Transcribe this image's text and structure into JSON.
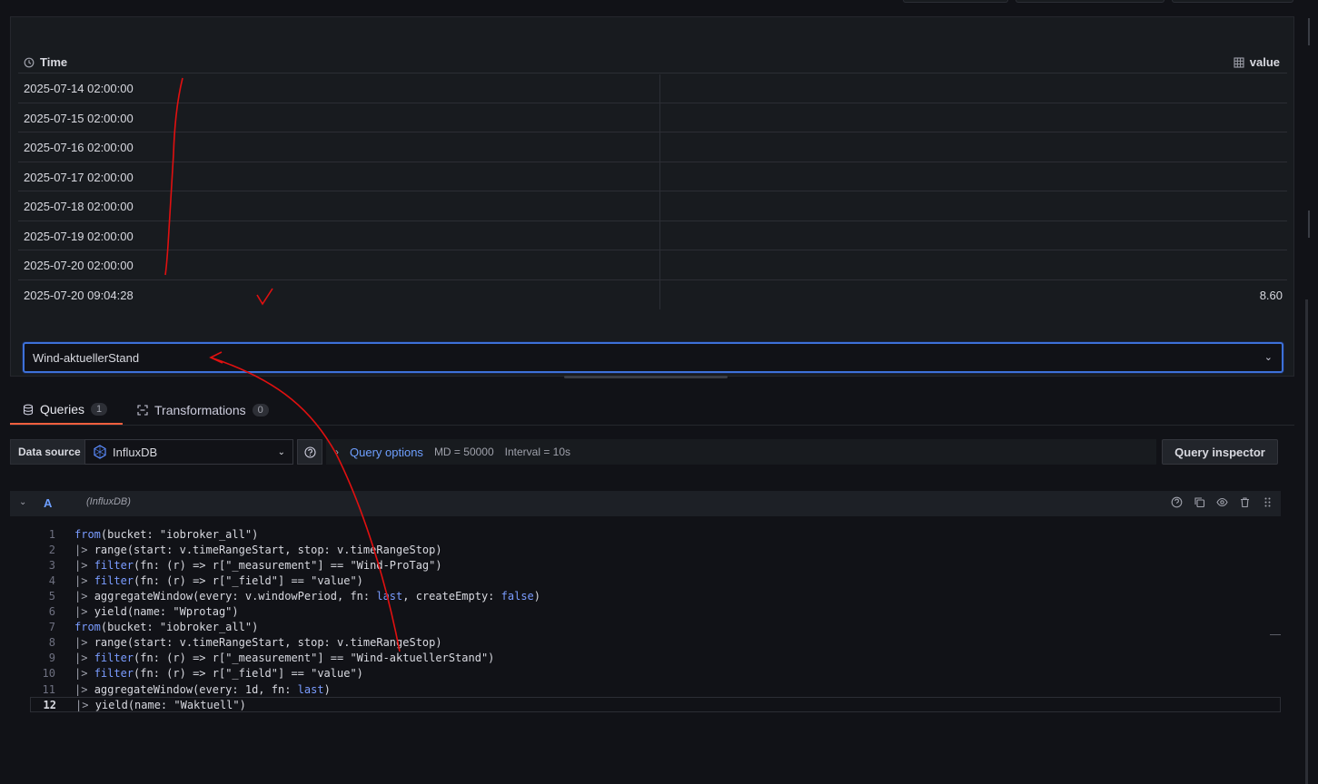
{
  "table": {
    "columns": {
      "time": "Time",
      "value": "value"
    },
    "rows": [
      {
        "time": "2025-07-14 02:00:00",
        "value": ""
      },
      {
        "time": "2025-07-15 02:00:00",
        "value": ""
      },
      {
        "time": "2025-07-16 02:00:00",
        "value": ""
      },
      {
        "time": "2025-07-17 02:00:00",
        "value": ""
      },
      {
        "time": "2025-07-18 02:00:00",
        "value": ""
      },
      {
        "time": "2025-07-19 02:00:00",
        "value": ""
      },
      {
        "time": "2025-07-20 02:00:00",
        "value": ""
      },
      {
        "time": "2025-07-20 09:04:28",
        "value": "8.60"
      }
    ]
  },
  "frame_select": {
    "value": "Wind-aktuellerStand"
  },
  "tabs": [
    {
      "label": "Queries",
      "count": "1"
    },
    {
      "label": "Transformations",
      "count": "0"
    }
  ],
  "datasource": {
    "label": "Data source",
    "name": "InfluxDB",
    "query_options_label": "Query options",
    "md": "MD = 50000",
    "interval": "Interval = 10s",
    "inspector_label": "Query inspector"
  },
  "query": {
    "ref": "A",
    "ds_name": "(InfluxDB)"
  },
  "code_lines": [
    "from(bucket: \"iobroker_all\")",
    "|> range(start: v.timeRangeStart, stop: v.timeRangeStop)",
    "|> filter(fn: (r) => r[\"_measurement\"] == \"Wind-ProTag\")",
    "|> filter(fn: (r) => r[\"_field\"] == \"value\")",
    "|> aggregateWindow(every: v.windowPeriod, fn: last, createEmpty: false)",
    "|> yield(name: \"Wprotag\")",
    "from(bucket: \"iobroker_all\")",
    "|> range(start: v.timeRangeStart, stop: v.timeRangeStop)",
    "|> filter(fn: (r) => r[\"_measurement\"] == \"Wind-aktuellerStand\")",
    "|> filter(fn: (r) => r[\"_field\"] == \"value\")",
    "|> aggregateWindow(every: 1d, fn: last)",
    "|> yield(name: \"Waktuell\")"
  ],
  "line_numbers": [
    "1",
    "2",
    "3",
    "4",
    "5",
    "6",
    "7",
    "8",
    "9",
    "10",
    "11",
    "12"
  ],
  "colors": {
    "accent_blue": "#6e9fff",
    "active_tab": "#f55f3e",
    "annotation": "#e01010",
    "select_border": "#3d71d9"
  },
  "icons": [
    "clock-icon",
    "table-icon",
    "chevron-down-icon",
    "database-icon",
    "transform-icon",
    "influxdb-icon",
    "help-icon",
    "chevron-right-icon",
    "copy-icon",
    "eye-icon",
    "trash-icon",
    "drag-handle-icon"
  ]
}
